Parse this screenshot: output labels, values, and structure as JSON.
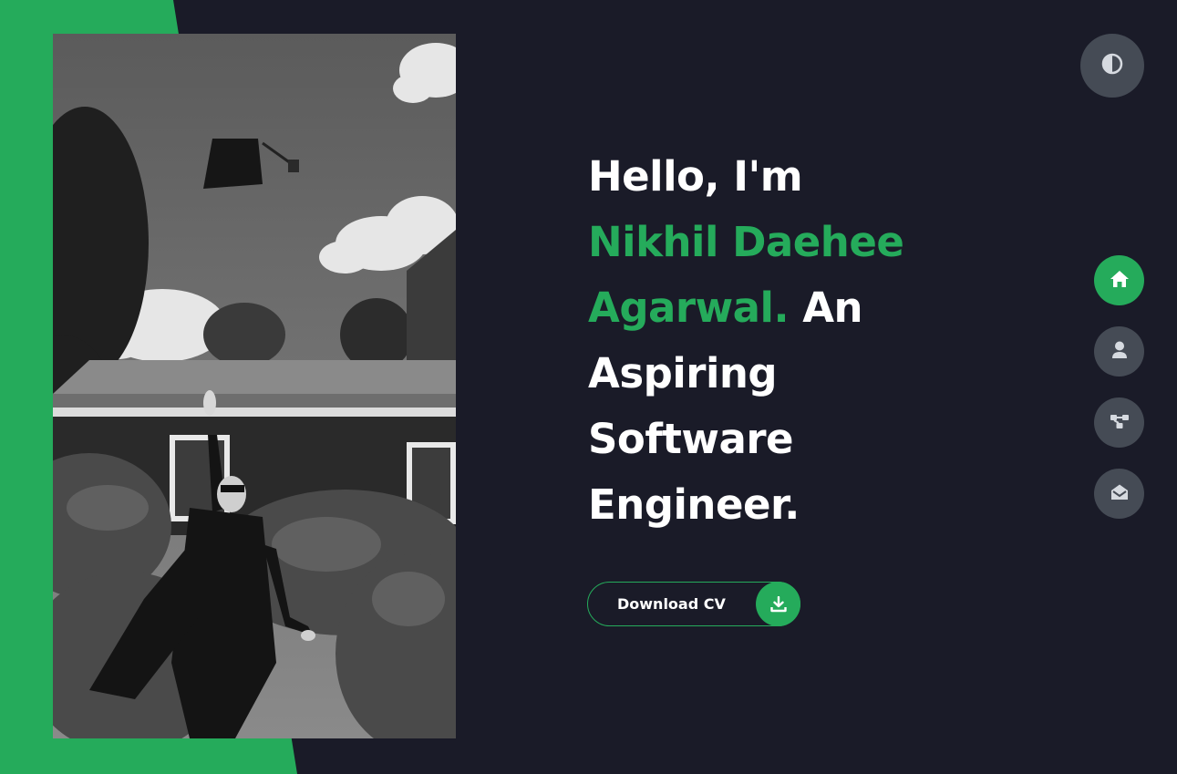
{
  "hero": {
    "greeting": "Hello, I'm",
    "name_line1": "Nikhil Daehee",
    "name_line2": "Agarwal.",
    "tagline_start": " An",
    "tagline_line2": "Aspiring",
    "tagline_line3": "Software",
    "tagline_line4": "Engineer."
  },
  "cv_button": {
    "label": "Download CV",
    "icon": "download-icon"
  },
  "theme_toggle": {
    "icon": "contrast-icon"
  },
  "nav": {
    "items": [
      {
        "name": "home",
        "icon": "home-icon",
        "active": true
      },
      {
        "name": "about",
        "icon": "user-icon",
        "active": false
      },
      {
        "name": "portfolio",
        "icon": "network-icon",
        "active": false
      },
      {
        "name": "contact",
        "icon": "envelope-open-icon",
        "active": false
      }
    ]
  },
  "colors": {
    "accent": "#25ab5b",
    "background": "#1a1b28",
    "button_gray": "#454b55",
    "text": "#ffffff"
  }
}
